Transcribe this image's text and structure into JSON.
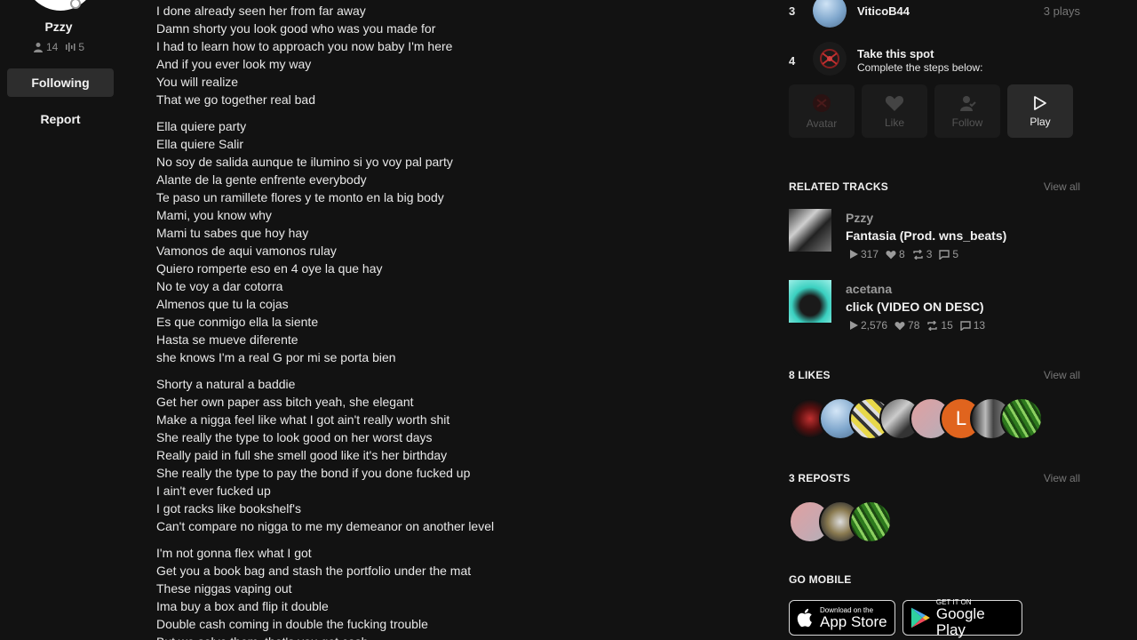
{
  "artist": {
    "name": "Pzzy",
    "followers": "14",
    "tracks": "5",
    "following_label": "Following",
    "report_label": "Report"
  },
  "lyrics": [
    [
      "I done already seen her from far away",
      "Damn shorty you look good who was you made for",
      "I had to learn how to approach you now baby I'm here",
      "And if you ever look my way",
      "You will realize",
      "That we go together real bad"
    ],
    [
      "Ella quiere party",
      "Ella quiere Salir",
      "No soy de salida aunque te ilumino si yo voy pal party",
      "Alante de la gente enfrente everybody",
      "Te paso un ramillete flores y te monto en la big body",
      "Mami, you know why",
      "Mami tu sabes que hoy hay",
      "Vamonos de aqui vamonos rulay",
      "Quiero romperte eso en 4 oye la que hay",
      "No te voy a dar cotorra",
      "Almenos que tu la cojas",
      "Es que conmigo ella la siente",
      "Hasta se mueve diferente",
      "she knows I'm a real G por mi se porta bien"
    ],
    [
      "Shorty a natural a baddie",
      "Get her own paper ass bitch yeah, she elegant",
      "Make a nigga feel like what I got ain't really worth shit",
      "She really the type to look good on her worst days",
      "Really paid in full she smell good like it's her birthday",
      "She really the type to pay the bond if you done fucked up",
      "I ain't ever fucked up",
      "I got racks like bookshelf's",
      "Can't compare no nigga to me my demeanor on another level"
    ],
    [
      "I'm not gonna flex what I got",
      "Get you a book bag and stash the portfolio under the mat",
      "These niggas vaping out",
      "Ima buy a box and flip it double",
      "Double cash coming in double the fucking trouble",
      "But we solve them, that's you got cash"
    ]
  ],
  "top_listeners": [
    {
      "rank": "3",
      "name": "ViticoB44",
      "plays": "3 plays"
    },
    {
      "rank": "4",
      "name": "Take this spot",
      "sub": "Complete the steps below:"
    }
  ],
  "steps": [
    {
      "label": "Avatar",
      "icon": "avatar-icon"
    },
    {
      "label": "Like",
      "icon": "heart-icon"
    },
    {
      "label": "Follow",
      "icon": "follow-icon"
    },
    {
      "label": "Play",
      "icon": "play-icon"
    }
  ],
  "related": {
    "title": "RELATED TRACKS",
    "view_all": "View all",
    "tracks": [
      {
        "artist": "Pzzy",
        "title": "Fantasia (Prod. wns_beats)",
        "plays": "317",
        "likes": "8",
        "reposts": "3",
        "comments": "5"
      },
      {
        "artist": "acetana",
        "title": "click (VIDEO ON DESC)",
        "plays": "2,576",
        "likes": "78",
        "reposts": "15",
        "comments": "13"
      }
    ]
  },
  "likes": {
    "title": "8 LIKES",
    "view_all": "View all",
    "letter_avatar": "L"
  },
  "reposts": {
    "title": "3 REPOSTS",
    "view_all": "View all"
  },
  "mobile": {
    "title": "GO MOBILE",
    "app_store_small": "Download on the",
    "app_store_big": "App Store",
    "google_small": "GET IT ON",
    "google_big": "Google Play"
  },
  "colors": {
    "background": "#121212",
    "panel": "#2d2d2d",
    "muted": "#777777"
  }
}
